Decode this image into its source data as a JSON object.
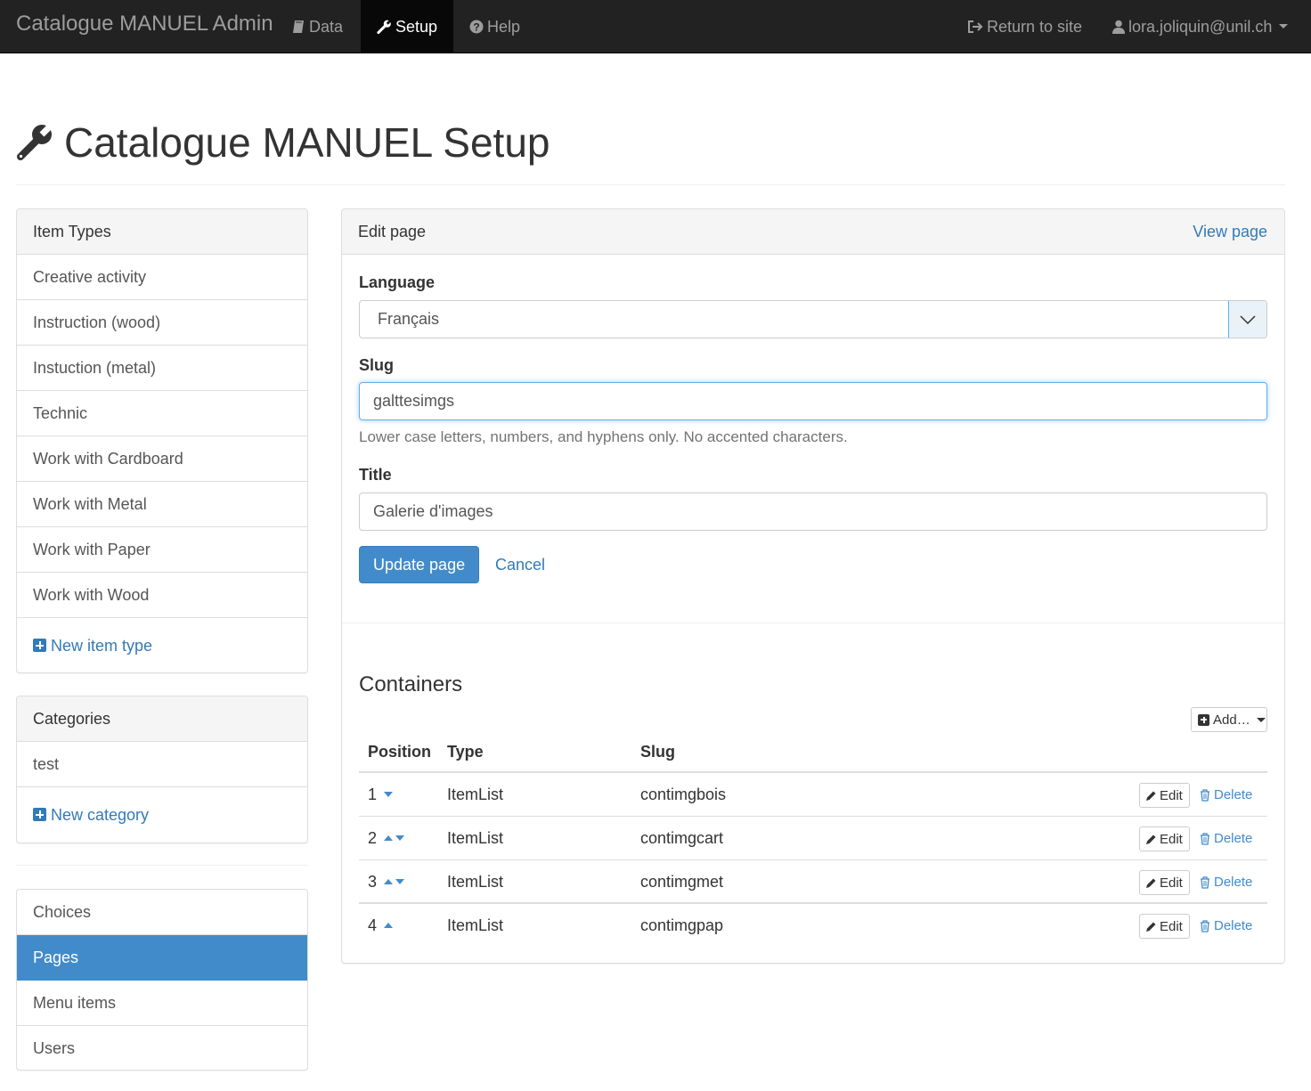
{
  "navbar": {
    "brand": "Catalogue MANUEL Admin",
    "items": [
      {
        "label": "Data",
        "icon": "book-icon"
      },
      {
        "label": "Setup",
        "icon": "wrench-icon",
        "active": true
      },
      {
        "label": "Help",
        "icon": "question-circle-icon"
      }
    ],
    "return_label": "Return to site",
    "user_email": "lora.joliquin@unil.ch"
  },
  "page": {
    "title": "Catalogue MANUEL Setup"
  },
  "sidebar": {
    "item_types": {
      "heading": "Item Types",
      "items": [
        "Creative activity",
        "Instruction (wood)",
        "Instuction (metal)",
        "Technic",
        "Work with Cardboard",
        "Work with Metal",
        "Work with Paper",
        "Work with Wood"
      ],
      "add_label": "New item type"
    },
    "categories": {
      "heading": "Categories",
      "items": [
        "test"
      ],
      "add_label": "New category"
    },
    "nav": {
      "items": [
        "Choices",
        "Pages",
        "Menu items",
        "Users"
      ],
      "selected": "Pages"
    }
  },
  "edit_page": {
    "heading": "Edit page",
    "view_link": "View page",
    "language": {
      "label": "Language",
      "value": "Français"
    },
    "slug": {
      "label": "Slug",
      "value": "galttesimgs",
      "help": "Lower case letters, numbers, and hyphens only. No accented characters."
    },
    "title": {
      "label": "Title",
      "value": "Galerie d'images"
    },
    "update_button": "Update page",
    "cancel_link": "Cancel"
  },
  "containers": {
    "title": "Containers",
    "add_button": "Add…",
    "columns": [
      "Position",
      "Type",
      "Slug"
    ],
    "rows": [
      {
        "position": "1",
        "type": "ItemList",
        "slug": "contimgbois",
        "arrows": [
          "down"
        ]
      },
      {
        "position": "2",
        "type": "ItemList",
        "slug": "contimgcart",
        "arrows": [
          "up",
          "down"
        ]
      },
      {
        "position": "3",
        "type": "ItemList",
        "slug": "contimgmet",
        "arrows": [
          "up",
          "down"
        ]
      },
      {
        "position": "4",
        "type": "ItemList",
        "slug": "contimgpap",
        "arrows": [
          "up"
        ]
      }
    ],
    "edit_label": "Edit",
    "delete_label": "Delete"
  },
  "colors": {
    "navbar_bg": "#222222",
    "navbar_active_bg": "#080808",
    "link": "#337ab7",
    "primary": "#428bca"
  }
}
